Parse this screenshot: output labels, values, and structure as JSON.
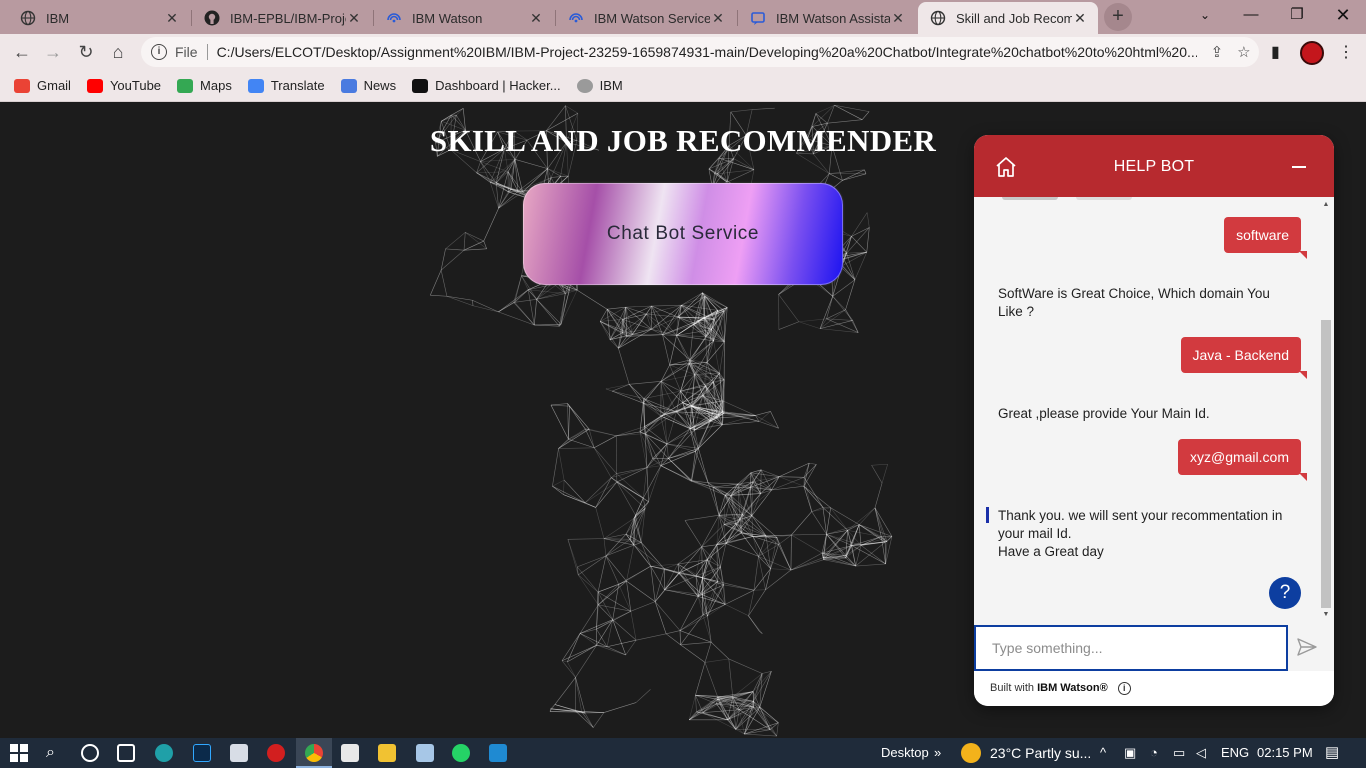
{
  "browser": {
    "tabs": [
      {
        "title": "IBM",
        "active": false
      },
      {
        "title": "IBM-EPBL/IBM-Project",
        "active": false
      },
      {
        "title": "IBM Watson",
        "active": false
      },
      {
        "title": "IBM Watson Service P",
        "active": false
      },
      {
        "title": "IBM Watson Assistant",
        "active": false
      },
      {
        "title": "Skill and Job Recomm",
        "active": true
      }
    ],
    "new_tab": "+",
    "omnibox": {
      "scheme_label": "File",
      "url": "C:/Users/ELCOT/Desktop/Assignment%20IBM/IBM-Project-23259-1659874931-main/Developing%20a%20Chatbot/Integrate%20chatbot%20to%20html%20..."
    },
    "bookmarks": [
      {
        "label": "Gmail",
        "color": "#ea4335"
      },
      {
        "label": "YouTube",
        "color": "#ff0000"
      },
      {
        "label": "Maps",
        "color": "#34a853"
      },
      {
        "label": "Translate",
        "color": "#4285f4"
      },
      {
        "label": "News",
        "color": "#4a7be0"
      },
      {
        "label": "Dashboard | Hacker...",
        "color": "#111111"
      },
      {
        "label": "IBM",
        "color": "#9a9a9a"
      }
    ]
  },
  "page": {
    "title": "SKILL AND JOB RECOMMENDER",
    "chat_button_label": "Chat Bot Service"
  },
  "chat": {
    "header_title": "HELP BOT",
    "messages": [
      {
        "from": "user",
        "text": "software"
      },
      {
        "from": "bot",
        "lines": [
          "SoftWare is Great Choice, Which domain You",
          "Like ?"
        ]
      },
      {
        "from": "user",
        "text": "Java - Backend"
      },
      {
        "from": "bot",
        "lines": [
          "Great ,please provide Your Main Id."
        ]
      },
      {
        "from": "user",
        "text": "xyz@gmail.com"
      },
      {
        "from": "bot",
        "lines": [
          "Thank you. we will sent your recommentation in",
          "your mail Id.",
          "Have a Great day"
        ]
      }
    ],
    "help_label": "?",
    "input_placeholder": "Type something...",
    "footer_prefix": "Built with ",
    "footer_brand": "IBM Watson®",
    "info_glyph": "i"
  },
  "taskbar": {
    "desktop_label": "Desktop",
    "weather": "23°C  Partly su...",
    "language": "ENG",
    "time": "02:15 PM"
  },
  "colors": {
    "chat_header": "#b72a2f",
    "user_bubble": "#d23a3f",
    "accent_blue": "#0d3ea0"
  }
}
